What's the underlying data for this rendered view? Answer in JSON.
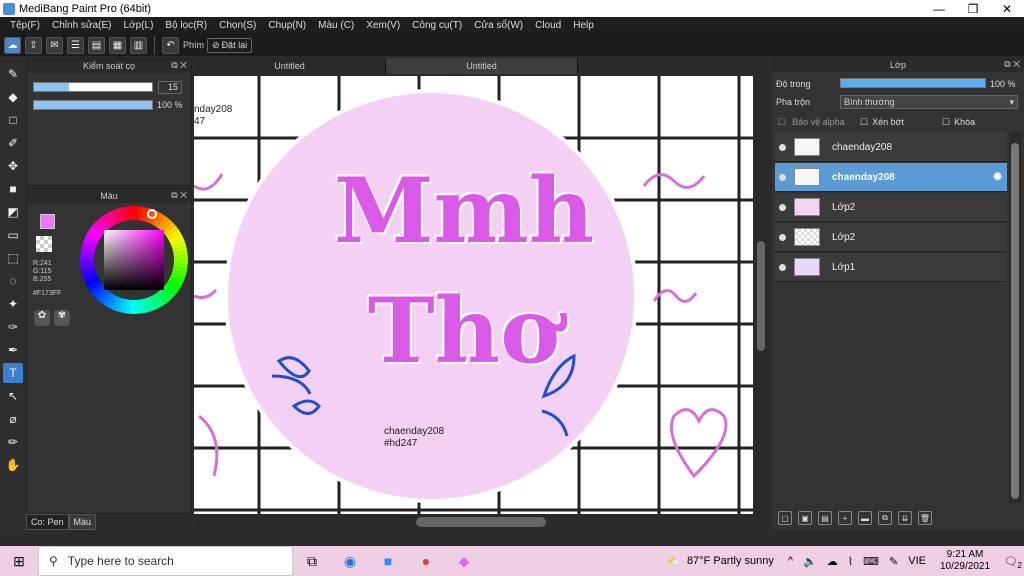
{
  "window": {
    "title": "MediBang Paint Pro (64bit)",
    "controls": [
      "—",
      "❐",
      "✕"
    ]
  },
  "menu": [
    "Tệp(F)",
    "Chỉnh sửa(E)",
    "Lớp(L)",
    "Bộ lọc(R)",
    "Chọn(S)",
    "Chụp(N)",
    "Màu (C)",
    "Xem(V)",
    "Công cụ(T)",
    "Cửa sổ(W)",
    "Cloud",
    "Help"
  ],
  "toolbar": {
    "phim_label": "Phím",
    "reset_label": "Đặt lại"
  },
  "brush_panel": {
    "title": "Kiểm soát cọ",
    "size_value": "15",
    "opacity_value": "100 %",
    "size_fraction": 0.3,
    "opacity_fraction": 1.0
  },
  "color_panel": {
    "title": "Màu",
    "r": "R:241",
    "g": "G:115",
    "b": "B:255",
    "hex": "#F173FF",
    "fg_color": "#f173ff"
  },
  "left_tabs": {
    "pen": "Co: Pen",
    "color": "Màu"
  },
  "doc_tabs": [
    "Untitled",
    "Untitled"
  ],
  "canvas": {
    "corner_text_line1": "nday208",
    "corner_text_line2": "47",
    "signature_line1": "chaenday208",
    "signature_line2": "#hd247",
    "lettering_line1": "Mmh",
    "lettering_line2": "Thơ"
  },
  "layer_panel": {
    "title": "Lớp",
    "opacity_label": "Độ trong",
    "opacity_value": "100 %",
    "opacity_fraction": 1.0,
    "blend_label": "Pha trộn",
    "blend_value": "Bình thường",
    "protect_alpha": "Bảo vệ alpha",
    "clip": "Xén bớt",
    "lock": "Khóa",
    "layers": [
      {
        "name": "chaenday208",
        "selected": false,
        "thumb": "chaenday"
      },
      {
        "name": "chaenday208",
        "selected": true,
        "thumb": "chaenday"
      },
      {
        "name": "Lớp2",
        "selected": false,
        "thumb": "Mmh"
      },
      {
        "name": "Lớp2",
        "selected": false,
        "thumb": ""
      },
      {
        "name": "Lớp1",
        "selected": false,
        "thumb": ""
      }
    ]
  },
  "taskbar": {
    "search_placeholder": "Type here to search",
    "weather": "87°F  Partly sunny",
    "lang": "VIE",
    "time": "9:21 AM",
    "date": "10/29/2021",
    "notif": "2"
  }
}
